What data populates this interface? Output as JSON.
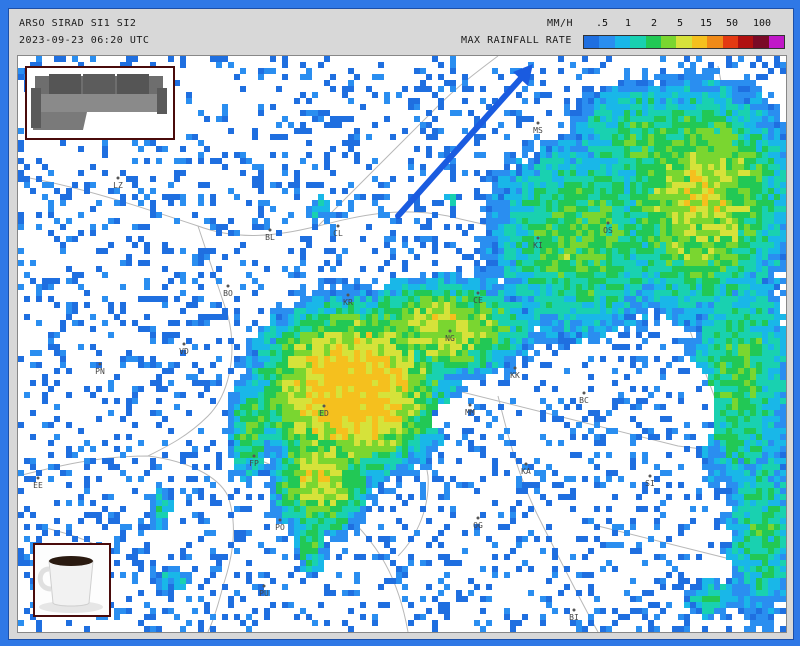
{
  "header": {
    "line1": "ARSO SIRAD SI1 SI2",
    "line2": "2023-09-23 06:20 UTC",
    "unit": "MM/H",
    "legend_title": "MAX RAINFALL RATE",
    "legend_values": [
      ".5",
      "1",
      "2",
      "5",
      "15",
      "50",
      "100"
    ],
    "legend_colors": [
      "#1f6fe0",
      "#2a8ef0",
      "#19b7e8",
      "#19d1b0",
      "#22c855",
      "#7ad630",
      "#d6e23a",
      "#f5c01e",
      "#f08a18",
      "#e43a12",
      "#b01010",
      "#7a0a26",
      "#c018c8"
    ]
  },
  "map": {
    "cities": [
      {
        "code": "LZ"
      },
      {
        "code": "BL"
      },
      {
        "code": "CL"
      },
      {
        "code": "BO"
      },
      {
        "code": "VD"
      },
      {
        "code": "PN"
      },
      {
        "code": "KR"
      },
      {
        "code": "CE"
      },
      {
        "code": "NG"
      },
      {
        "code": "KK"
      },
      {
        "code": "MM"
      },
      {
        "code": "ED"
      },
      {
        "code": "BC"
      },
      {
        "code": "KA"
      },
      {
        "code": "SI"
      },
      {
        "code": "FP"
      },
      {
        "code": "PO"
      },
      {
        "code": "OG"
      },
      {
        "code": "PU"
      },
      {
        "code": "BI"
      },
      {
        "code": "EE"
      },
      {
        "code": "MS"
      },
      {
        "code": "KI"
      },
      {
        "code": "OS"
      }
    ],
    "arrow_color": "#1a5be0"
  },
  "thumbnails": {
    "sofa": "sofa-image",
    "cup": "coffee-cup-image"
  }
}
